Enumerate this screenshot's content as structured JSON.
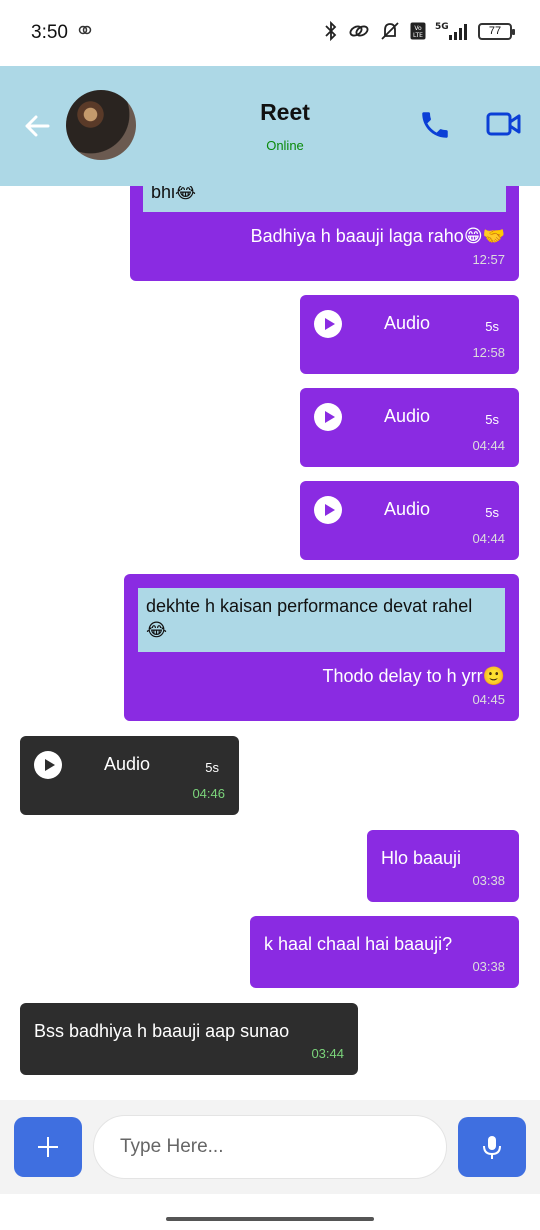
{
  "status_bar": {
    "time": "3:50",
    "battery": "77"
  },
  "header": {
    "name": "Reet",
    "status": "Online"
  },
  "messages": {
    "m0": {
      "reply": "bhi😂",
      "text": "Badhiya h baauji laga raho😁🤝",
      "time": "12:57"
    },
    "m1": {
      "label": "Audio",
      "duration": "5s",
      "time": "12:58"
    },
    "m2": {
      "label": "Audio",
      "duration": "5s",
      "time": "04:44"
    },
    "m3": {
      "label": "Audio",
      "duration": "5s",
      "time": "04:44"
    },
    "m4": {
      "reply": "dekhte h kaisan performance devat rahel 😂",
      "text": "Thodo delay to h yrr🙂",
      "time": "04:45"
    },
    "m5": {
      "label": "Audio",
      "duration": "5s",
      "time": "04:46"
    },
    "m6": {
      "text": "Hlo baauji",
      "time": "03:38"
    },
    "m7": {
      "text": "k haal chaal hai baauji?",
      "time": "03:38"
    },
    "m8": {
      "text": "Bss badhiya h baauji aap sunao",
      "time": "03:44"
    }
  },
  "composer": {
    "placeholder": "Type Here..."
  },
  "colors": {
    "header_bg": "#add8e6",
    "sent_bubble": "#8a2be2",
    "received_bubble": "#2d2d2d",
    "reply_bg": "#add8e6",
    "action_button": "#3f6fe0",
    "online": "#0a8a0a"
  },
  "icons": {
    "back": "arrow-left-icon",
    "call": "phone-icon",
    "video": "video-camera-icon",
    "play": "play-icon",
    "add": "plus-icon",
    "mic": "microphone-icon"
  }
}
